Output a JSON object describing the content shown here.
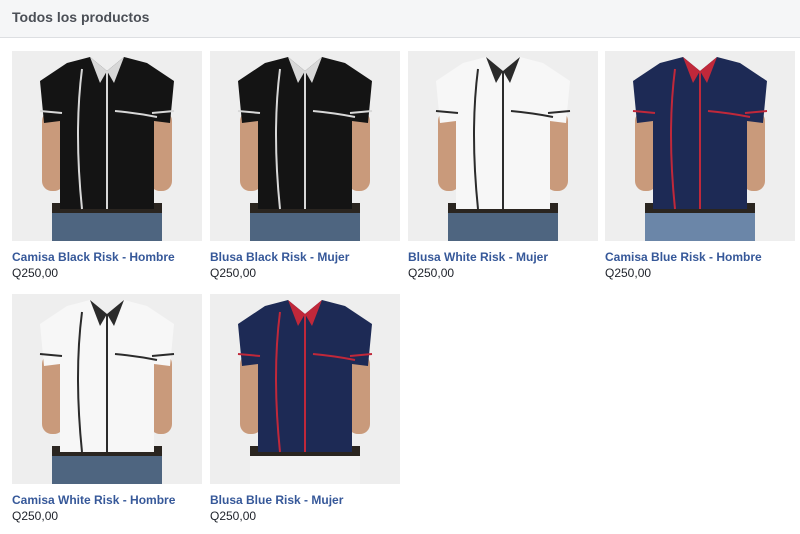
{
  "header": {
    "title": "Todos los productos"
  },
  "products": [
    {
      "name": "Camisa Black Risk - Hombre",
      "price": "Q250,00",
      "shirt_color": "#141414",
      "piping_color": "#d8d8d8",
      "pants_color": "#4e6580"
    },
    {
      "name": "Blusa Black Risk - Mujer",
      "price": "Q250,00",
      "shirt_color": "#141414",
      "piping_color": "#d8d8d8",
      "pants_color": "#4e6580"
    },
    {
      "name": "Blusa White Risk - Mujer",
      "price": "Q250,00",
      "shirt_color": "#f7f7f7",
      "piping_color": "#2b2b2b",
      "pants_color": "#4e6580"
    },
    {
      "name": "Camisa Blue Risk - Hombre",
      "price": "Q250,00",
      "shirt_color": "#1d2a55",
      "piping_color": "#c0283a",
      "pants_color": "#6b86a8"
    },
    {
      "name": "Camisa White Risk - Hombre",
      "price": "Q250,00",
      "shirt_color": "#f7f7f7",
      "piping_color": "#2b2b2b",
      "pants_color": "#4e6580"
    },
    {
      "name": "Blusa Blue Risk - Mujer",
      "price": "Q250,00",
      "shirt_color": "#1d2a55",
      "piping_color": "#c0283a",
      "pants_color": "#f2f2f2"
    }
  ]
}
